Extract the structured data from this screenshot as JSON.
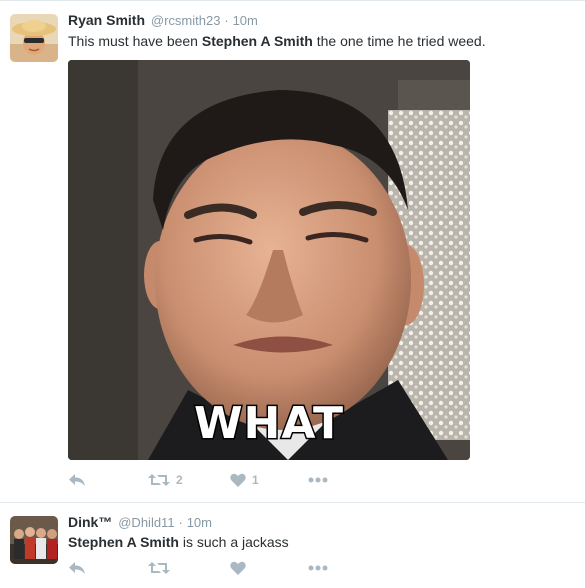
{
  "tweets": [
    {
      "fullname": "Ryan Smith",
      "username": "@rcsmith23",
      "separator": "·",
      "time": "10m",
      "text_before": "This must have been ",
      "text_bold": "Stephen A Smith",
      "text_after": " the one time he tried weed.",
      "media_caption": "WHAT",
      "retweet_count": "2",
      "like_count": "1"
    },
    {
      "fullname": "Dink™",
      "username": "@Dhild11",
      "separator": "·",
      "time": "10m",
      "text_before": "",
      "text_bold": "Stephen A Smith",
      "text_after": " is such a jackass",
      "retweet_count": "",
      "like_count": ""
    }
  ],
  "icons": {
    "reply": "reply-arrow-icon",
    "retweet": "retweet-icon",
    "like": "heart-icon",
    "more": "more-dots-icon"
  },
  "colors": {
    "name": "#292f33",
    "meta": "#8899a6",
    "action_icon": "#aab8c2",
    "divider": "#e1e8ed"
  }
}
